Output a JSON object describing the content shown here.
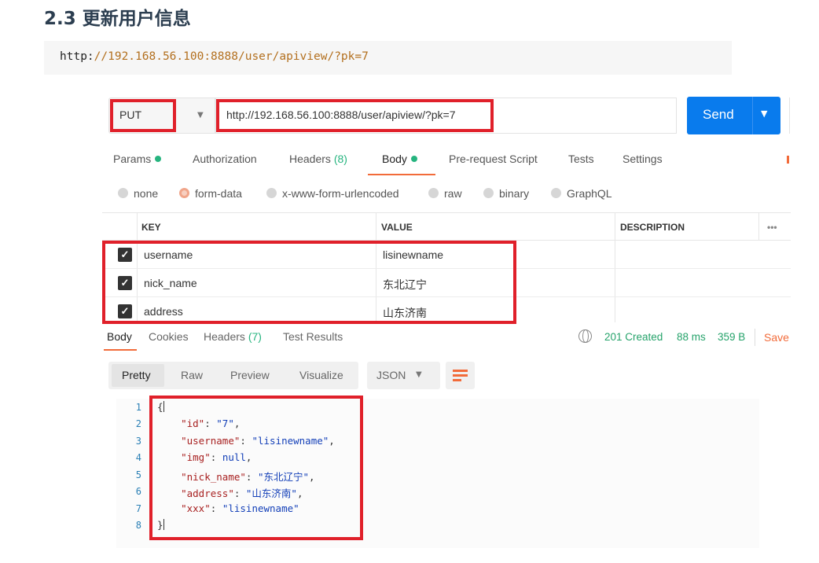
{
  "doc": {
    "heading": "2.3 更新用户信息",
    "code_scheme": "http:",
    "code_rest": "//192.168.56.100:8888/user/apiview/?pk=7"
  },
  "request": {
    "method": "PUT",
    "url": "http://192.168.56.100:8888/user/apiview/?pk=7",
    "send_label": "Send"
  },
  "req_tabs": {
    "params": "Params",
    "authorization": "Authorization",
    "headers": "Headers",
    "headers_count": "(8)",
    "body": "Body",
    "prerequest": "Pre-request Script",
    "tests": "Tests",
    "settings": "Settings"
  },
  "body_types": [
    "none",
    "form-data",
    "x-www-form-urlencoded",
    "raw",
    "binary",
    "GraphQL"
  ],
  "table": {
    "headers": {
      "key": "KEY",
      "value": "VALUE",
      "description": "DESCRIPTION",
      "more": "•••"
    },
    "rows": [
      {
        "key": "username",
        "value": "lisinewname"
      },
      {
        "key": "nick_name",
        "value": "东北辽宁"
      },
      {
        "key": "address",
        "value": "山东济南"
      }
    ]
  },
  "response_tabs": {
    "body": "Body",
    "cookies": "Cookies",
    "headers": "Headers",
    "headers_count": "(7)",
    "test_results": "Test Results"
  },
  "status": {
    "code": "201 Created",
    "time": "88 ms",
    "size": "359 B",
    "save": "Save"
  },
  "view_modes": [
    "Pretty",
    "Raw",
    "Preview",
    "Visualize"
  ],
  "format": "JSON",
  "json_lines": [
    "1",
    "2",
    "3",
    "4",
    "5",
    "6",
    "7",
    "8"
  ],
  "json_body": {
    "id_k": "\"id\"",
    "id_v": "\"7\"",
    "username_k": "\"username\"",
    "username_v": "\"lisinewname\"",
    "img_k": "\"img\"",
    "img_v": "null",
    "nick_k": "\"nick_name\"",
    "nick_v": "\"东北辽宁\"",
    "address_k": "\"address\"",
    "address_v": "\"山东济南\"",
    "xxx_k": "\"xxx\"",
    "xxx_v": "\"lisinewname\""
  },
  "colors": {
    "accent": "#f26b3a",
    "send": "#097bed",
    "status": "#26a36b",
    "highlight": "#e0202a"
  }
}
